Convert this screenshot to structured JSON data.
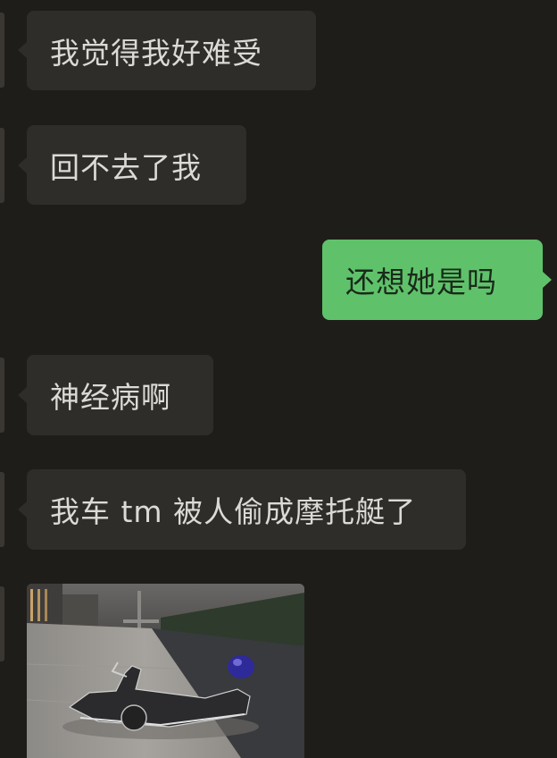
{
  "messages": [
    {
      "side": "received",
      "text": "我觉得我好难受"
    },
    {
      "side": "received",
      "text": "回不去了我"
    },
    {
      "side": "sent",
      "text": "还想她是吗"
    },
    {
      "side": "received",
      "text": "神经病啊"
    },
    {
      "side": "received",
      "text": "我车 tm 被人偷成摩托艇了"
    },
    {
      "side": "received",
      "type": "image",
      "icon": "scooter-photo"
    }
  ],
  "colors": {
    "background": "#1f1d19",
    "received_bubble": "#2f2d29",
    "sent_bubble": "#5fc26b",
    "received_text": "#dcdad6",
    "sent_text": "#1a2a1a"
  }
}
